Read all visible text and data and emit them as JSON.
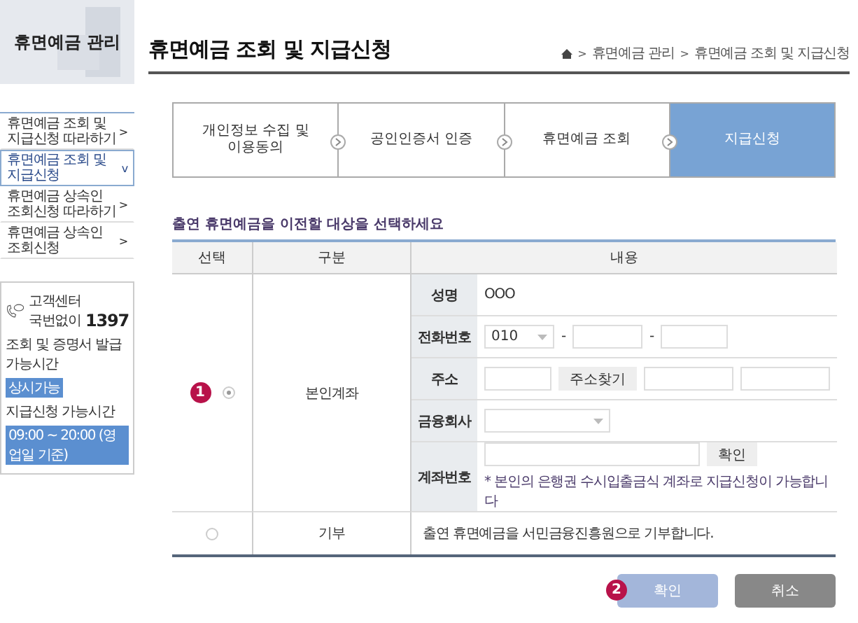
{
  "sidebar": {
    "title": "휴면예금 관리",
    "menu": [
      {
        "lines": [
          "휴면예금 조회 및",
          "지급신청 따라하기"
        ],
        "arrow": ">",
        "selected": false
      },
      {
        "lines": [
          "휴면예금 조회 및",
          "지급신청"
        ],
        "arrow": "v",
        "selected": true
      },
      {
        "lines": [
          "휴면예금 상속인",
          "조회신청 따라하기"
        ],
        "arrow": ">",
        "selected": false
      },
      {
        "lines": [
          "휴면예금 상속인",
          "조회신청"
        ],
        "arrow": ">",
        "selected": false
      }
    ],
    "contact": {
      "label": "고객센터",
      "prefix": "국번없이",
      "number": "1397",
      "hours": [
        {
          "label": "조회 및 증명서 발급 가능시간",
          "badge": "상시가능"
        },
        {
          "label": "지급신청 가능시간",
          "badge": "09:00 ~ 20:00 (영업일 기준)"
        }
      ]
    }
  },
  "page": {
    "title": "휴면예금 조회 및 지급신청",
    "breadcrumb": [
      {
        "separator": ">",
        "label": "휴면예금 관리"
      },
      {
        "separator": ">",
        "label": "휴면예금 조회 및 지급신청"
      }
    ]
  },
  "steps": [
    {
      "label": "개인정보 수집 및\n이용동의",
      "selected": false
    },
    {
      "label": "공인인증서 인증",
      "selected": false
    },
    {
      "label": "휴면예금 조회",
      "selected": false
    },
    {
      "label": "지급신청",
      "selected": true
    }
  ],
  "form": {
    "heading": "출연 휴면예금을 이전할 대상을 선택하세요",
    "columns": [
      "선택",
      "구분",
      "내용"
    ],
    "options": [
      {
        "kind": "account",
        "marker": "1",
        "selected": true,
        "category": "본인계좌"
      },
      {
        "kind": "donation",
        "selected": false,
        "category": "기부",
        "description": "출연 휴면예금을 서민금융진흥원으로 기부합니다."
      }
    ],
    "fields": [
      {
        "kind": "text",
        "label": "성명",
        "value": "OOO"
      },
      {
        "kind": "phone",
        "label": "전화번호",
        "value": "010",
        "separator": "-"
      },
      {
        "kind": "address",
        "label": "주소",
        "button": "주소찾기"
      },
      {
        "kind": "select",
        "label": "금융회사"
      },
      {
        "kind": "account",
        "label": "계좌번호",
        "button": "확인",
        "note": "* 본인의 은행권 수시입출금식 계좌로 지급신청이 가능합니다"
      }
    ]
  },
  "buttons": [
    {
      "kind": "primary",
      "label": "확인",
      "marker": "2"
    },
    {
      "kind": "secondary",
      "label": "취소"
    }
  ]
}
